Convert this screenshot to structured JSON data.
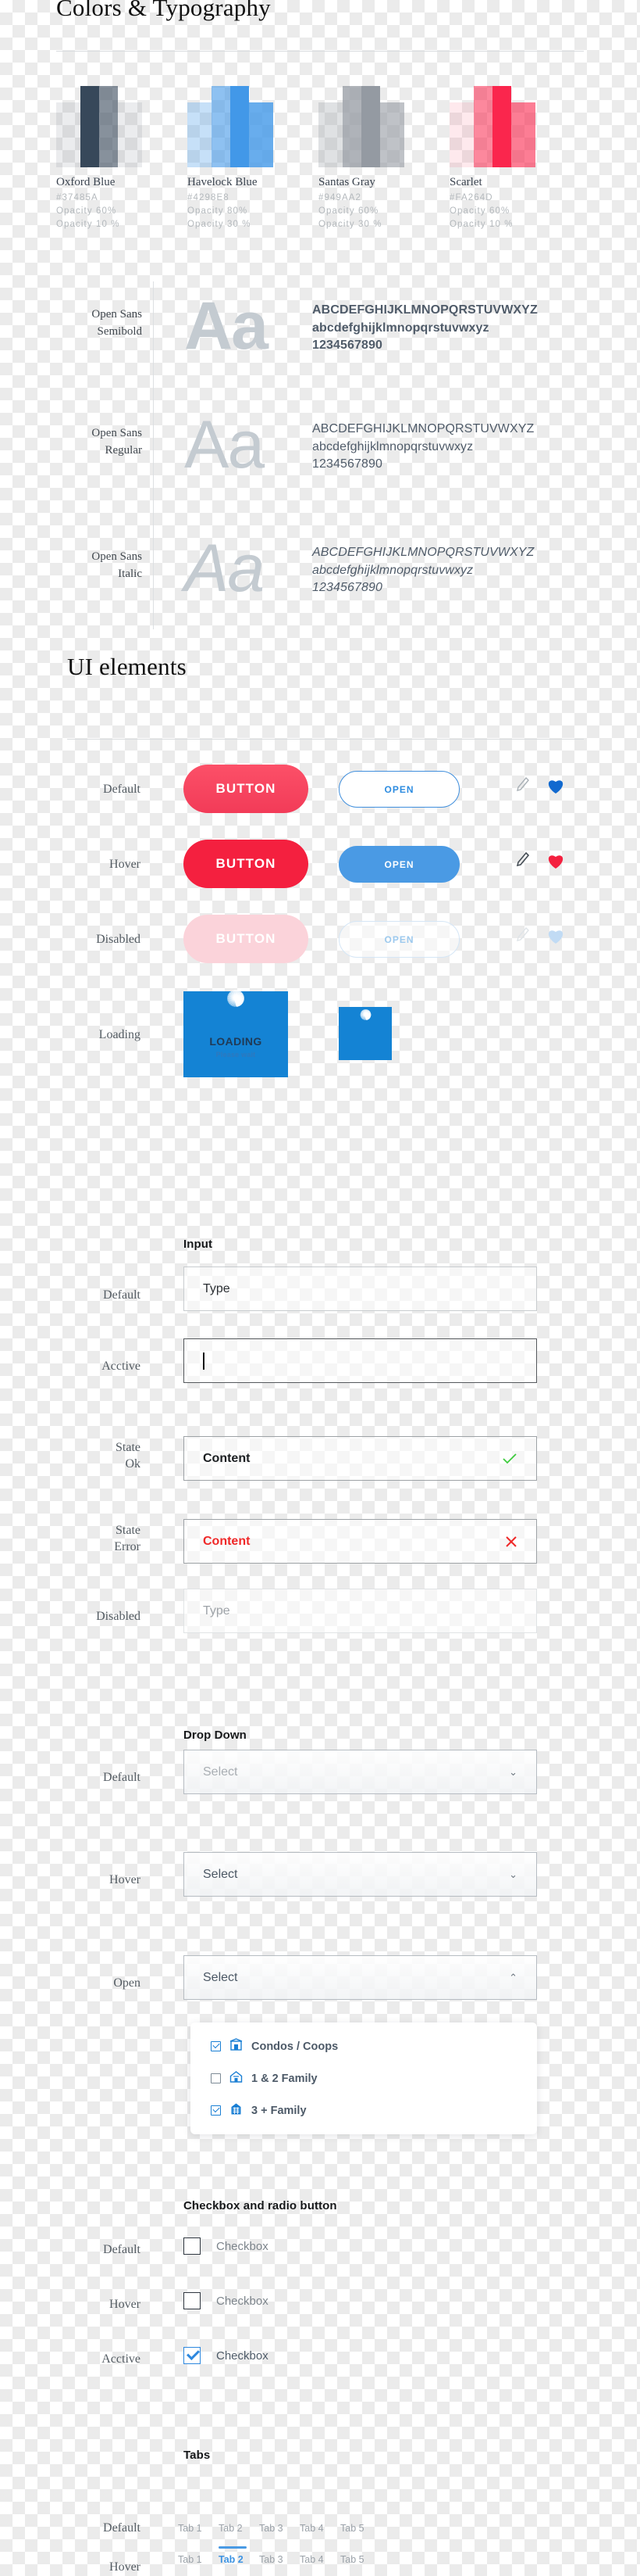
{
  "sections": {
    "colors_typography_title": "Colors & Typography",
    "ui_elements_title": "UI elements"
  },
  "colors": {
    "swatches": [
      {
        "name": "Oxford Blue",
        "hex": "#37485A",
        "opacity_1": "Opacity 60%",
        "opacity_2": "Opacity 10 %"
      },
      {
        "name": "Havelock Blue",
        "hex": "#4298E8",
        "opacity_1": "Opacity 80%",
        "opacity_2": "Opacity 30 %"
      },
      {
        "name": "Santas Gray",
        "hex": "#949AA2",
        "opacity_1": "Opacity 60%",
        "opacity_2": "Opacity 30 %"
      },
      {
        "name": "Scarlet",
        "hex": "#FA264D",
        "opacity_1": "Opacity 60%",
        "opacity_2": "Opacity 10 %"
      }
    ]
  },
  "typography": {
    "rows": [
      {
        "family": "Open Sans",
        "weight": "Semibold",
        "glyphs": "Aa",
        "upper": "ABCDEFGHIJKLMNOPQRSTUVWXYZ",
        "lower": "abcdefghijklmnopqrstuvwxyz",
        "digits": "1234567890"
      },
      {
        "family": "Open Sans",
        "weight": "Regular",
        "glyphs": "Aa",
        "upper": "ABCDEFGHIJKLMNOPQRSTUVWXYZ",
        "lower": "abcdefghijklmnopqrstuvwxyz",
        "digits": "1234567890"
      },
      {
        "family": "Open Sans",
        "weight": "Italic",
        "glyphs": "Aa",
        "upper": "ABCDEFGHIJKLMNOPQRSTUVWXYZ",
        "lower": "abcdefghijklmnopqrstuvwxyz",
        "digits": "1234567890"
      }
    ]
  },
  "buttons": {
    "states": [
      "Default",
      "Hover",
      "Disabled",
      "Loading"
    ],
    "primary_label": "BUTTON",
    "ghost_label": "OPEN",
    "loading_label": "LOADING",
    "loading_sub": "Please wait"
  },
  "input": {
    "group_title": "Input",
    "rows": [
      {
        "state": "Default",
        "value": "Type"
      },
      {
        "state": "Acctive",
        "value": ""
      },
      {
        "state": "State\nOk",
        "value": "Content"
      },
      {
        "state": "State\nError",
        "value": "Content"
      },
      {
        "state": "Disabled",
        "value": "Type"
      }
    ],
    "state_default": "Default",
    "state_active": "Acctive",
    "state_ok_line1": "State",
    "state_ok_line2": "Ok",
    "state_error_line1": "State",
    "state_error_line2": "Error",
    "state_disabled": "Disabled",
    "value_type": "Type",
    "value_content": "Content"
  },
  "dropdown": {
    "group_title": "Drop Down",
    "states": [
      "Default",
      "Hover",
      "Open"
    ],
    "placeholder": "Select",
    "chevron_down": "⌄",
    "chevron_up": "⌃",
    "options": [
      {
        "label": "Condos  / Coops",
        "checked": true,
        "icon": "condo-icon"
      },
      {
        "label": "1 & 2 Family",
        "checked": false,
        "icon": "house-icon"
      },
      {
        "label": "3 + Family",
        "checked": true,
        "icon": "apartment-icon"
      }
    ]
  },
  "checkbox": {
    "group_title": "Checkbox and radio button",
    "rows": [
      {
        "state": "Default",
        "label": "Checkbox",
        "checked": false
      },
      {
        "state": "Hover",
        "label": "Checkbox",
        "checked": false
      },
      {
        "state": "Acctive",
        "label": "Checkbox",
        "checked": true
      }
    ]
  },
  "tabs": {
    "group_title": "Tabs",
    "states": [
      "Default",
      "Hover"
    ],
    "labels": [
      "Tab 1",
      "Tab 2",
      "Tab 3",
      "Tab 4",
      "Tab 5"
    ],
    "active_index": 1
  },
  "palette": {
    "oxford_blue": "#37485A",
    "havelock_blue": "#4298E8",
    "santas_gray": "#949AA2",
    "scarlet": "#FA264D",
    "accent_blue": "#2E88DE",
    "ok_green": "#3ECB3E",
    "error_red": "#EF2828"
  }
}
